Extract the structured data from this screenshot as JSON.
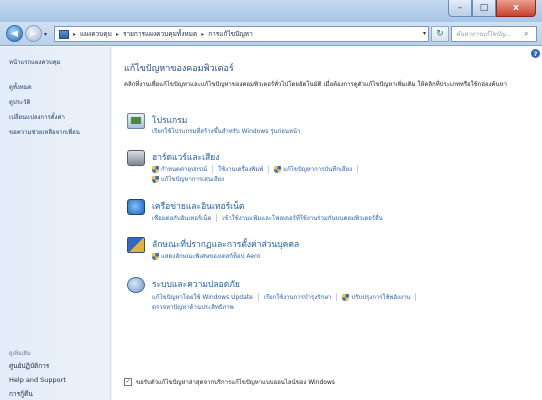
{
  "window": {
    "caption": {
      "minimize": "–",
      "maximize": "□",
      "close": "x"
    }
  },
  "nav": {
    "back_glyph": "◀",
    "forward_glyph": "▶",
    "recent_glyph": "▾",
    "breadcrumb": [
      "แผงควบคุม",
      "รายการแผงควบคุมทั้งหมด",
      "การแก้ไขปัญหา"
    ],
    "breadcrumb_sep": "▸",
    "address_dropdown": "▾",
    "refresh_glyph": "↻",
    "search_placeholder": "ค้นหาการแก้ไขปัญ..."
  },
  "sidebar": {
    "home": "หน้าแรกแผงควบคุม",
    "items": [
      "ดูทั้งหมด",
      "ดูประวัติ",
      "เปลี่ยนแปลงการตั้งค่า",
      "ขอความช่วยเหลือจากเพื่อน"
    ],
    "see_also": "ดูเพิ่มเติม",
    "bottom_items": [
      "ศูนย์ปฏิบัติการ",
      "Help and Support",
      "การกู้คืน"
    ]
  },
  "main": {
    "title": "แก้ไขปัญหาของคอมพิวเตอร์",
    "description": "คลิกที่งานเพื่อแก้ไขปัญหาและแก้ไขปัญหาของคอมพิวเตอร์ทั่วไปโดยอัตโนมัติ เมื่อต้องการดูตัวแก้ไขปัญหาเพิ่มเติม ให้คลิกที่ประเภทหรือใช้กล่องค้นหา",
    "categories": [
      {
        "title": "โปรแกรม",
        "rows": [
          [
            {
              "label": "เรียกใช้โปรแกรมที่สร้างขึ้นสำหรับ Windows รุ่นก่อนหน้า",
              "shield": false
            }
          ]
        ]
      },
      {
        "title": "ฮาร์ดแวร์และเสียง",
        "rows": [
          [
            {
              "label": "กำหนดค่าอุปกรณ์",
              "shield": true
            },
            {
              "label": "ใช้งานเครื่องพิมพ์",
              "shield": false
            },
            {
              "label": "แก้ไขปัญหาการบันทึกเสียง",
              "shield": true
            }
          ],
          [
            {
              "label": "แก้ไขปัญหาการเล่นเสียง",
              "shield": true
            }
          ]
        ]
      },
      {
        "title": "เครือข่ายและอินเทอร์เน็ต",
        "rows": [
          [
            {
              "label": "เชื่อมต่อกับอินเทอร์เน็ต",
              "shield": false
            },
            {
              "label": "เข้าใช้งานแฟ้มและโฟลเดอร์ที่ใช้งานร่วมกันบนคอมพิวเตอร์อื่น",
              "shield": false
            }
          ]
        ]
      },
      {
        "title": "ลักษณะที่ปรากฏและการตั้งค่าส่วนบุคคล",
        "rows": [
          [
            {
              "label": "แสดงลักษณะพิเศษของเดสก์ท็อป Aero",
              "shield": true
            }
          ]
        ]
      },
      {
        "title": "ระบบและความปลอดภัย",
        "rows": [
          [
            {
              "label": "แก้ไขปัญหาโดยใช้ Windows Update",
              "shield": false
            },
            {
              "label": "เรียกใช้งานการบำรุงรักษา",
              "shield": false
            },
            {
              "label": "ปรับปรุงการใช้พลังงาน",
              "shield": true
            }
          ],
          [
            {
              "label": "ตรวจหาปัญหาด้านประสิทธิภาพ",
              "shield": false
            }
          ]
        ]
      }
    ],
    "footer_checkbox_glyph": "✓",
    "footer_text": "ขอรับตัวแก้ไขปัญหาล่าสุดจากบริการแก้ไขปัญหาแบบออนไลน์ของ Windows"
  }
}
